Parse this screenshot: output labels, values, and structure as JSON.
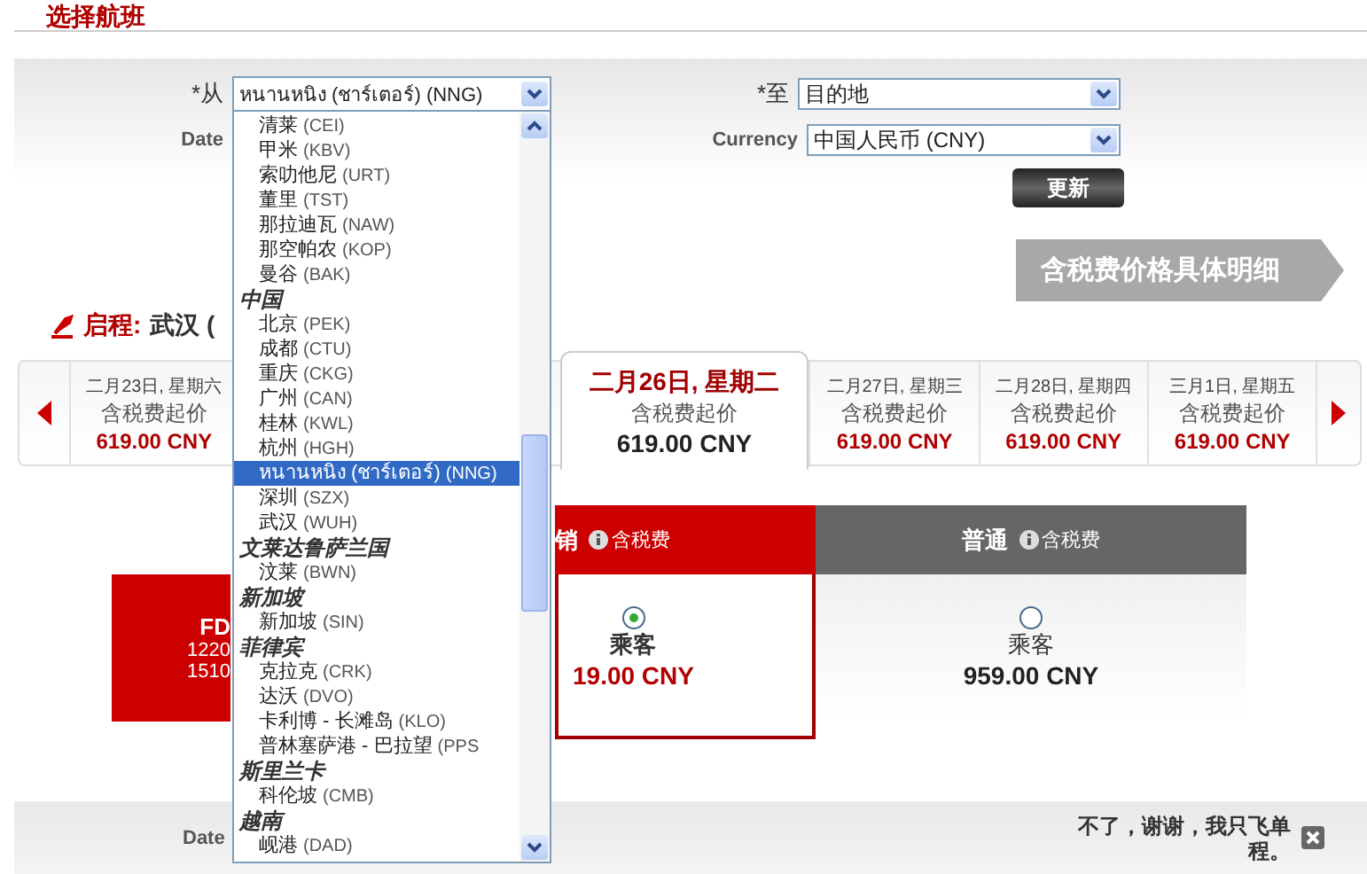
{
  "title": "选择航班",
  "form": {
    "from": {
      "label": "*从"
    },
    "date_label": "Date",
    "to": {
      "label": "*至",
      "value": "目的地"
    },
    "currency": {
      "label": "Currency",
      "value": "中国人民币 (CNY)"
    },
    "update_button": "更新"
  },
  "price_details_banner": "含税费价格具体明细",
  "departure": {
    "label": "启程:",
    "city": "武汉 ("
  },
  "dates": [
    {
      "date": "二月23日, 星期六",
      "label": "含税费起价",
      "price": "619.00 CNY",
      "selected": false
    },
    {
      "date": "二月26日, 星期二",
      "label": "含税费起价",
      "price": "619.00 CNY",
      "selected": true
    },
    {
      "date": "二月27日, 星期三",
      "label": "含税费起价",
      "price": "619.00 CNY",
      "selected": false
    },
    {
      "date": "二月28日, 星期四",
      "label": "含税费起价",
      "price": "619.00 CNY",
      "selected": false
    },
    {
      "date": "三月1日, 星期五",
      "label": "含税费起价",
      "price": "619.00 CNY",
      "selected": false
    }
  ],
  "flight": {
    "code": "FD",
    "depart": "1220",
    "arrive": "1510"
  },
  "fares": [
    {
      "title": "销",
      "note": "含税费",
      "color": "#cc0000",
      "selected": true,
      "passenger": "乘客",
      "price": "19.00 CNY"
    },
    {
      "title": "普通",
      "note": "含税费",
      "color": "#666666",
      "selected": false,
      "passenger": "乘客",
      "price": "959.00 CNY"
    }
  ],
  "return_bar": {
    "date_label": "Date",
    "one_way": "不了，谢谢，我只飞单程。"
  },
  "origin_dropdown": {
    "value": "หนานหนิง (ชาร์เตอร์) (NNG)",
    "items": [
      {
        "kind": "option",
        "name": "清莱",
        "code": "(CEI)",
        "selected": false
      },
      {
        "kind": "option",
        "name": "甲米",
        "code": "(KBV)",
        "selected": false
      },
      {
        "kind": "option",
        "name": "索叻他尼",
        "code": "(URT)",
        "selected": false
      },
      {
        "kind": "option",
        "name": "董里",
        "code": "(TST)",
        "selected": false
      },
      {
        "kind": "option",
        "name": "那拉迪瓦",
        "code": "(NAW)",
        "selected": false
      },
      {
        "kind": "option",
        "name": "那空帕农",
        "code": "(KOP)",
        "selected": false
      },
      {
        "kind": "option",
        "name": "曼谷",
        "code": "(BAK)",
        "selected": false
      },
      {
        "kind": "group",
        "name": "中国"
      },
      {
        "kind": "option",
        "name": "北京",
        "code": "(PEK)",
        "selected": false
      },
      {
        "kind": "option",
        "name": "成都",
        "code": "(CTU)",
        "selected": false
      },
      {
        "kind": "option",
        "name": "重庆",
        "code": "(CKG)",
        "selected": false
      },
      {
        "kind": "option",
        "name": "广州",
        "code": "(CAN)",
        "selected": false
      },
      {
        "kind": "option",
        "name": "桂林",
        "code": "(KWL)",
        "selected": false
      },
      {
        "kind": "option",
        "name": "杭州",
        "code": "(HGH)",
        "selected": false
      },
      {
        "kind": "option",
        "name": "หนานหนิง (ชาร์เตอร์)",
        "code": "(NNG)",
        "selected": true
      },
      {
        "kind": "option",
        "name": "深圳",
        "code": "(SZX)",
        "selected": false
      },
      {
        "kind": "option",
        "name": "武汉",
        "code": "(WUH)",
        "selected": false
      },
      {
        "kind": "group",
        "name": "文莱达鲁萨兰国"
      },
      {
        "kind": "option",
        "name": "汶莱",
        "code": "(BWN)",
        "selected": false
      },
      {
        "kind": "group",
        "name": "新加坡"
      },
      {
        "kind": "option",
        "name": "新加坡",
        "code": "(SIN)",
        "selected": false
      },
      {
        "kind": "group",
        "name": "菲律宾"
      },
      {
        "kind": "option",
        "name": "克拉克",
        "code": "(CRK)",
        "selected": false
      },
      {
        "kind": "option",
        "name": "达沃",
        "code": "(DVO)",
        "selected": false
      },
      {
        "kind": "option",
        "name": "卡利博 - 长滩岛",
        "code": "(KLO)",
        "selected": false
      },
      {
        "kind": "option",
        "name": "普林塞萨港 - 巴拉望",
        "code": "(PPS",
        "selected": false
      },
      {
        "kind": "group",
        "name": "斯里兰卡"
      },
      {
        "kind": "option",
        "name": "科伦坡",
        "code": "(CMB)",
        "selected": false
      },
      {
        "kind": "group",
        "name": "越南"
      },
      {
        "kind": "option",
        "name": "岘港",
        "code": "(DAD)",
        "selected": false
      }
    ]
  }
}
